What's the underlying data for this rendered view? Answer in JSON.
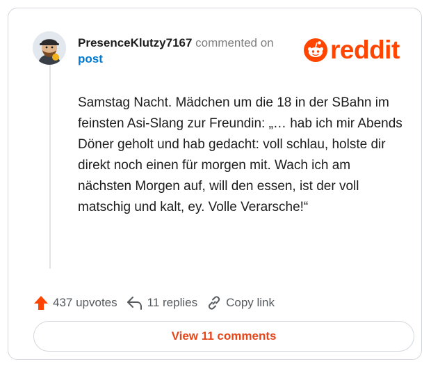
{
  "comment": {
    "username": "PresenceKlutzy7167",
    "action_text": "commented on",
    "post_link": "post",
    "body": "Samstag Nacht. Mädchen um die 18 in der SBahn im feinsten Asi-Slang zur Freundin: „… hab ich mir Abends Döner geholt und hab gedacht: voll schlau, holste dir direkt noch einen für morgen mit. Wach ich am nächsten Morgen auf, will den essen, ist der voll matschig und kalt, ey. Volle Verarsche!“"
  },
  "brand": {
    "name": "reddit",
    "color": "#ff4500"
  },
  "actions": {
    "upvotes": "437 upvotes",
    "replies": "11 replies",
    "copy_link": "Copy link"
  },
  "view_comments_label": "View 11 comments",
  "colors": {
    "username_link": "#0079d3",
    "upvote_arrow": "#ff4500",
    "view_button_text": "#e5461a"
  }
}
